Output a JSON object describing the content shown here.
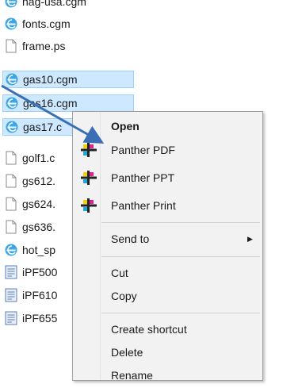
{
  "files": [
    {
      "name": "nag-usa.cgm",
      "icon": "cgm-file-icon",
      "selected": false
    },
    {
      "name": "fonts.cgm",
      "icon": "cgm-file-icon",
      "selected": false
    },
    {
      "name": "frame.ps",
      "icon": "blank-file-icon",
      "selected": false
    },
    {
      "name": "gas10.cgm",
      "icon": "cgm-file-icon",
      "selected": true
    },
    {
      "name": "gas16.cgm",
      "icon": "cgm-file-icon",
      "selected": true
    },
    {
      "name": "gas17.c",
      "icon": "cgm-file-icon",
      "selected": true
    },
    {
      "name": "golf1.c",
      "icon": "blank-file-icon",
      "selected": false
    },
    {
      "name": "gs612.",
      "icon": "blank-file-icon",
      "selected": false
    },
    {
      "name": "gs624.",
      "icon": "blank-file-icon",
      "selected": false
    },
    {
      "name": "gs636.",
      "icon": "blank-file-icon",
      "selected": false
    },
    {
      "name": "hot_sp",
      "icon": "cgm-file-icon",
      "selected": false
    },
    {
      "name": "iPF500",
      "icon": "document-file-icon",
      "selected": false
    },
    {
      "name": "iPF610",
      "icon": "document-file-icon",
      "selected": false
    },
    {
      "name": "iPF655",
      "icon": "document-file-icon",
      "selected": false
    }
  ],
  "context_menu": {
    "items": [
      {
        "label": "Open",
        "bold": true,
        "icon": "",
        "submenu": false
      },
      {
        "label": "Panther PDF",
        "bold": false,
        "icon": "panther-icon",
        "submenu": false
      },
      {
        "label": "Panther PPT",
        "bold": false,
        "icon": "panther-icon",
        "submenu": false
      },
      {
        "label": "Panther Print",
        "bold": false,
        "icon": "panther-icon",
        "submenu": false
      },
      {
        "label": "Send to",
        "bold": false,
        "icon": "",
        "submenu": true
      },
      {
        "label": "Cut",
        "bold": false,
        "icon": "",
        "submenu": false
      },
      {
        "label": "Copy",
        "bold": false,
        "icon": "",
        "submenu": false
      },
      {
        "label": "Create shortcut",
        "bold": false,
        "icon": "",
        "submenu": false
      },
      {
        "label": "Delete",
        "bold": false,
        "icon": "",
        "submenu": false
      },
      {
        "label": "Rename",
        "bold": false,
        "icon": "",
        "submenu": false
      }
    ]
  },
  "colors": {
    "selection_bg": "#cde8ff",
    "selection_border": "#99d1ff",
    "menu_bg": "#f2f2f2",
    "arrow": "#3a6fb6"
  }
}
